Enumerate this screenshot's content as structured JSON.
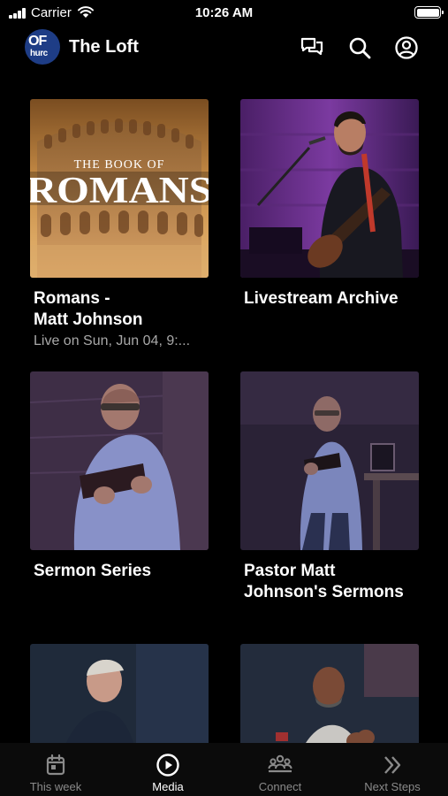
{
  "status_bar": {
    "carrier": "Carrier",
    "time": "10:26 AM"
  },
  "header": {
    "logo_text_top": "OF",
    "logo_text_bottom": "hurc",
    "title": "The Loft",
    "icons": [
      "chat-icon",
      "search-icon",
      "profile-icon"
    ]
  },
  "cards": [
    {
      "title_line1": "Romans -",
      "title_line2": "Matt Johnson",
      "subtitle": "Live on Sun, Jun 04, 9:...",
      "art_line1": "THE BOOK OF",
      "art_line2": "ROMANS"
    },
    {
      "title_line1": "Livestream Archive"
    },
    {
      "title_line1": "Sermon Series"
    },
    {
      "title_line1": "Pastor Matt",
      "title_line2": "Johnson's Sermons"
    },
    {
      "title_line1": ""
    },
    {
      "title_line1": ""
    }
  ],
  "tabbar": {
    "tabs": [
      {
        "label": "This week",
        "icon": "calendar-icon",
        "active": false
      },
      {
        "label": "Media",
        "icon": "play-circle-icon",
        "active": true
      },
      {
        "label": "Connect",
        "icon": "people-group-icon",
        "active": false
      },
      {
        "label": "Next Steps",
        "icon": "double-chevron-right-icon",
        "active": false
      }
    ]
  },
  "colors": {
    "background": "#000000",
    "logo_bg": "#1e3d86",
    "inactive_tab": "#8a8a8a"
  }
}
